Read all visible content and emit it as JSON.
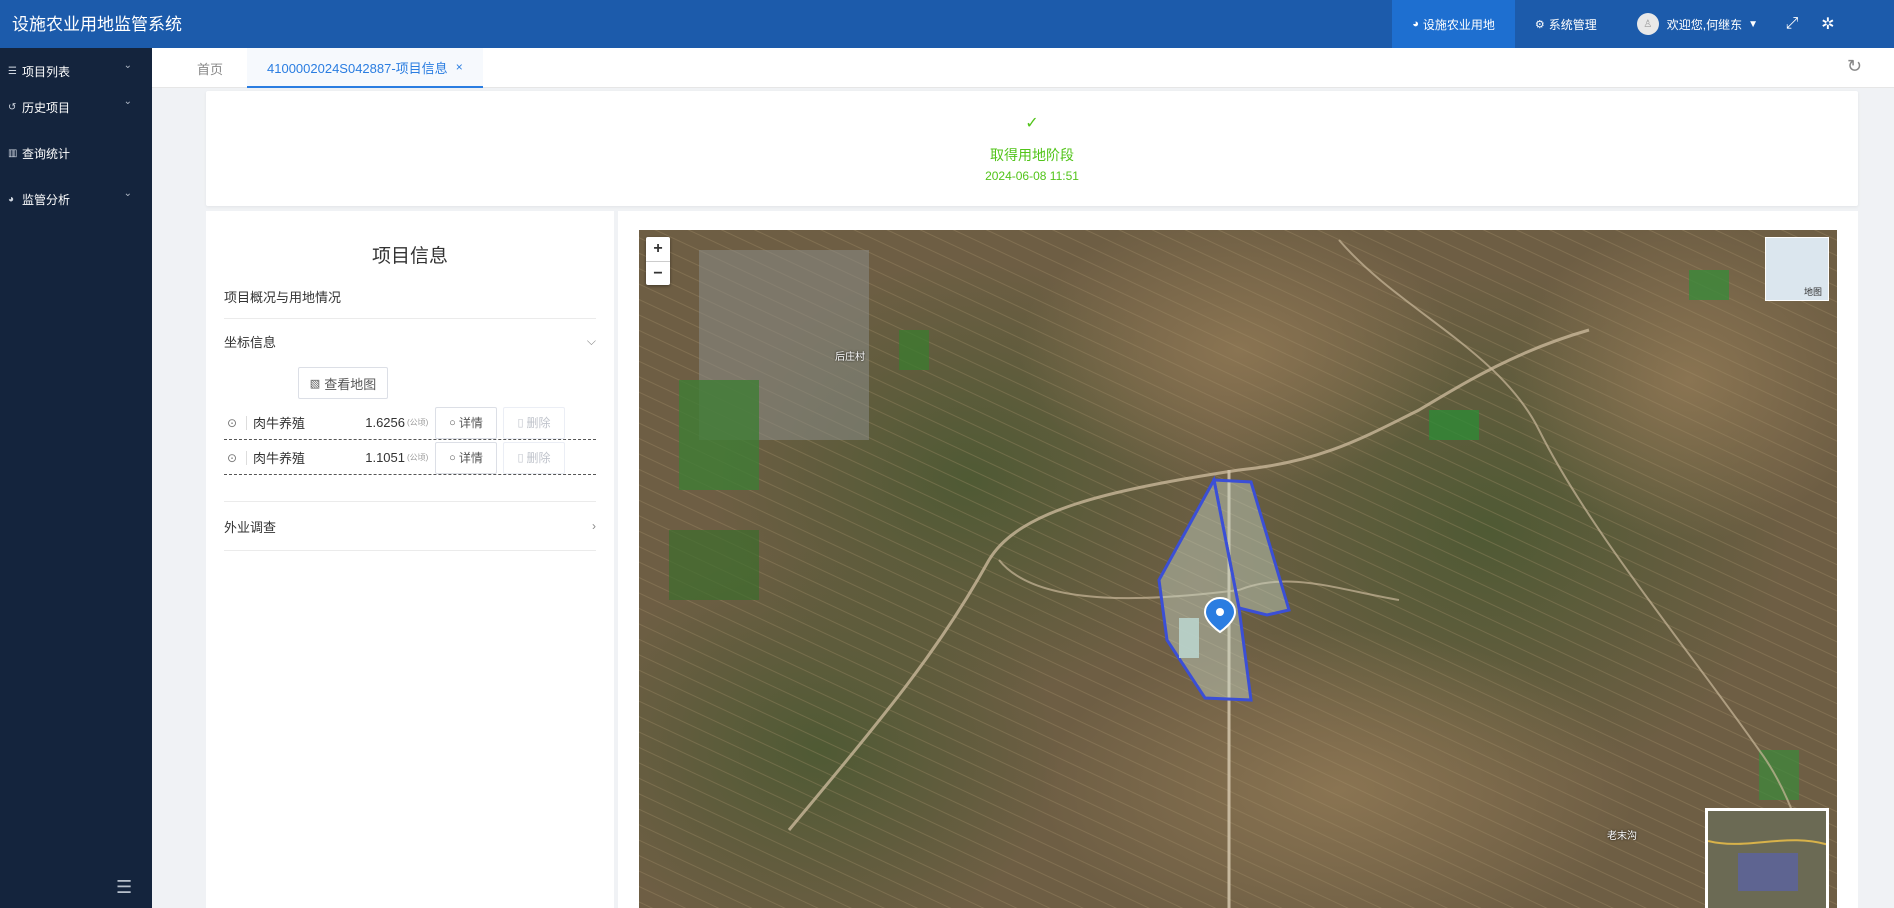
{
  "header": {
    "app_title": "设施农业用地监管系统",
    "nav_items": [
      {
        "label": "设施农业用地",
        "icon": "pie-chart-icon",
        "active": true
      },
      {
        "label": "系统管理",
        "icon": "gears-icon",
        "active": false
      }
    ],
    "user_greeting": "欢迎您,何继东",
    "icons": [
      "fullscreen-icon",
      "settings-icon"
    ]
  },
  "sidebar": {
    "items": [
      {
        "label": "项目列表",
        "icon": "list-icon"
      },
      {
        "label": "历史项目",
        "icon": "history-icon"
      },
      {
        "label": "查询统计",
        "icon": "bar-chart-icon"
      },
      {
        "label": "监管分析",
        "icon": "pie-chart-icon"
      }
    ]
  },
  "tabs": {
    "home": "首页",
    "active": "4100002024S042887-项目信息",
    "close_glyph": "×"
  },
  "status": {
    "stage": "取得用地阶段",
    "time": "2024-06-08 11:51",
    "color": "#52c41a"
  },
  "project_info": {
    "title": "项目信息",
    "overview_label": "项目概况与用地情况",
    "coord_label": "坐标信息",
    "view_map_label": "查看地图",
    "coords": [
      {
        "name": "肉牛养殖",
        "area": "1.6256",
        "unit": "(公顷)",
        "detail_label": "详情",
        "delete_label": "删除"
      },
      {
        "name": "肉牛养殖",
        "area": "1.1051",
        "unit": "(公顷)",
        "detail_label": "详情",
        "delete_label": "删除"
      }
    ],
    "field_survey_label": "外业调查"
  },
  "map": {
    "zoom_in": "+",
    "zoom_out": "−",
    "layer_label": "地图",
    "place_labels": [
      "后庄村",
      "老末沟"
    ],
    "parcel_color": "#3b4fd6"
  },
  "colors": {
    "header_bg": "#1c5bab",
    "sidebar_bg": "#14243d",
    "accent": "#2a7de1"
  }
}
